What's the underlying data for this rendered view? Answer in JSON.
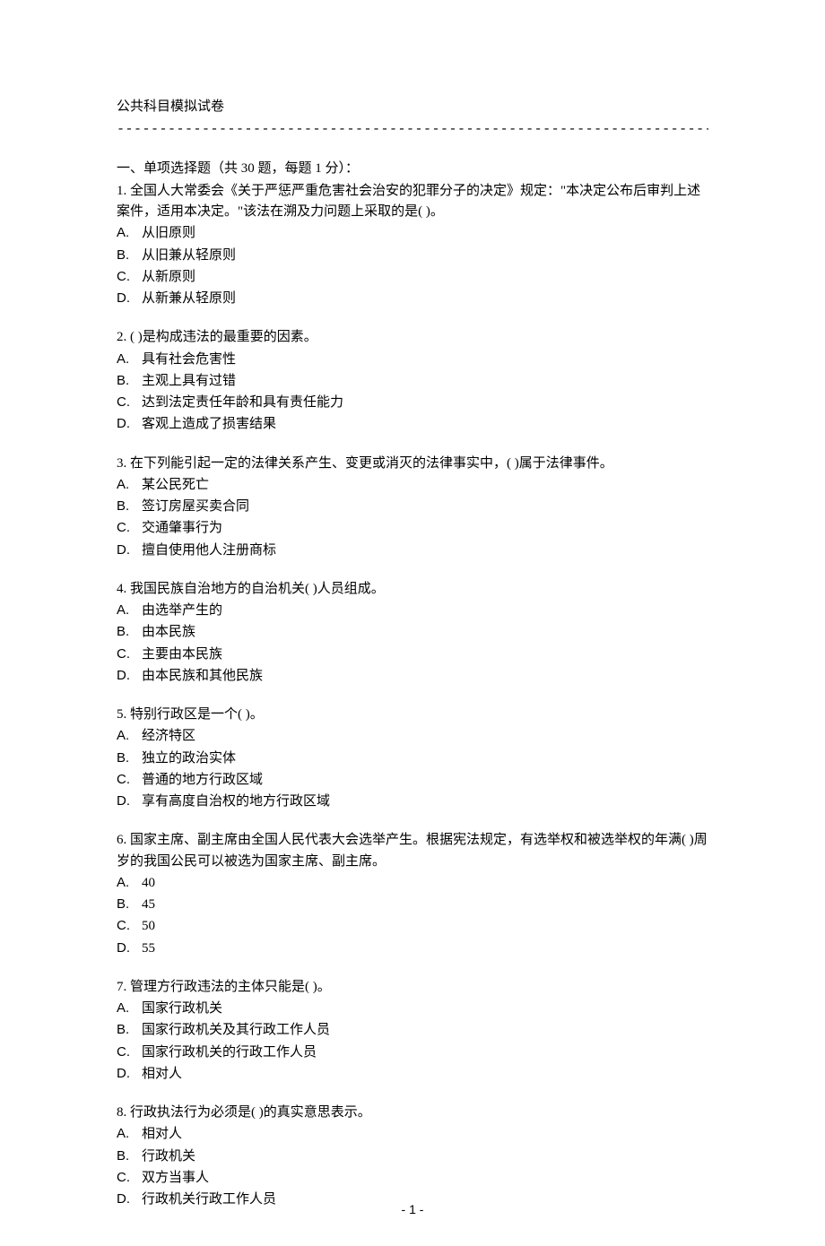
{
  "header": {
    "title": "公共科目模拟试卷",
    "divider": "--------------------------------------------------------------------------------"
  },
  "section": {
    "heading": "一、单项选择题（共 30 题，每题 1 分）："
  },
  "questions": [
    {
      "num": "1.",
      "text": "全国人大常委会《关于严惩严重危害社会治安的犯罪分子的决定》规定：\"本决定公布后审判上述案件，适用本决定。\"该法在溯及力问题上采取的是( )。",
      "options": [
        {
          "label": "A.",
          "text": "从旧原则"
        },
        {
          "label": "B.",
          "text": "从旧兼从轻原则"
        },
        {
          "label": "C.",
          "text": "从新原则"
        },
        {
          "label": "D.",
          "text": "从新兼从轻原则"
        }
      ]
    },
    {
      "num": "2.",
      "text": "( )是构成违法的最重要的因素。",
      "options": [
        {
          "label": "A.",
          "text": "具有社会危害性"
        },
        {
          "label": "B.",
          "text": "主观上具有过错"
        },
        {
          "label": "C.",
          "text": "达到法定责任年龄和具有责任能力"
        },
        {
          "label": "D.",
          "text": "客观上造成了损害结果"
        }
      ]
    },
    {
      "num": "3.",
      "text": "在下列能引起一定的法律关系产生、变更或消灭的法律事实中，( )属于法律事件。",
      "options": [
        {
          "label": "A.",
          "text": "某公民死亡"
        },
        {
          "label": "B.",
          "text": "签订房屋买卖合同"
        },
        {
          "label": "C.",
          "text": "交通肇事行为"
        },
        {
          "label": "D.",
          "text": "擅自使用他人注册商标"
        }
      ]
    },
    {
      "num": "4.",
      "text": "我国民族自治地方的自治机关( )人员组成。",
      "options": [
        {
          "label": "A.",
          "text": "由选举产生的"
        },
        {
          "label": "B.",
          "text": "由本民族"
        },
        {
          "label": "C.",
          "text": "主要由本民族"
        },
        {
          "label": "D.",
          "text": "由本民族和其他民族"
        }
      ]
    },
    {
      "num": "5.",
      "text": "特别行政区是一个( )。",
      "options": [
        {
          "label": "A.",
          "text": "经济特区"
        },
        {
          "label": "B.",
          "text": "独立的政治实体"
        },
        {
          "label": "C.",
          "text": "普通的地方行政区域"
        },
        {
          "label": "D.",
          "text": "享有高度自治权的地方行政区域"
        }
      ]
    },
    {
      "num": "6.",
      "text": "国家主席、副主席由全国人民代表大会选举产生。根据宪法规定，有选举权和被选举权的年满( )周岁的我国公民可以被选为国家主席、副主席。",
      "options": [
        {
          "label": "A.",
          "text": "40"
        },
        {
          "label": "B.",
          "text": "45"
        },
        {
          "label": "C.",
          "text": "50"
        },
        {
          "label": "D.",
          "text": "55"
        }
      ]
    },
    {
      "num": "7.",
      "text": "管理方行政违法的主体只能是( )。",
      "options": [
        {
          "label": "A.",
          "text": "国家行政机关"
        },
        {
          "label": "B.",
          "text": "国家行政机关及其行政工作人员"
        },
        {
          "label": "C.",
          "text": "国家行政机关的行政工作人员"
        },
        {
          "label": "D.",
          "text": "相对人"
        }
      ]
    },
    {
      "num": "8.",
      "text": "行政执法行为必须是( )的真实意思表示。",
      "options": [
        {
          "label": "A.",
          "text": "相对人"
        },
        {
          "label": "B.",
          "text": "行政机关"
        },
        {
          "label": "C.",
          "text": "双方当事人"
        },
        {
          "label": "D.",
          "text": "行政机关行政工作人员"
        }
      ]
    }
  ],
  "footer": {
    "page_number": "- 1 -"
  }
}
